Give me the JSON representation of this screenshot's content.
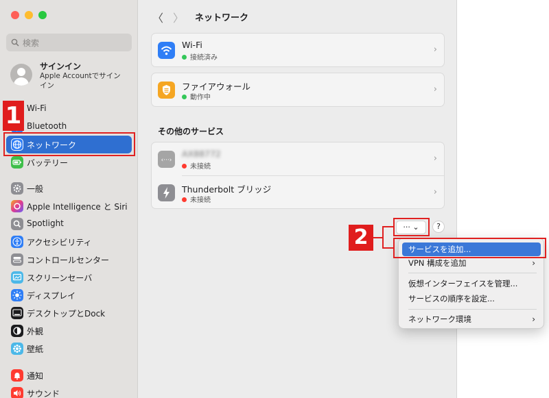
{
  "sidebar": {
    "search_placeholder": "検索",
    "account": {
      "title": "サインイン",
      "subtitle": "Apple Accountでサインイン"
    },
    "items": [
      {
        "label": "Wi-Fi",
        "icon": "wifi-icon",
        "color": "#2f7ef6"
      },
      {
        "label": "Bluetooth",
        "icon": "bluetooth-icon",
        "color": "#2f7ef6"
      },
      {
        "label": "ネットワーク",
        "icon": "globe-icon",
        "color": "#2f7ef6",
        "selected": true
      },
      {
        "label": "バッテリー",
        "icon": "battery-icon",
        "color": "#3fbf4a"
      },
      {
        "label": "一般",
        "icon": "gear-icon",
        "color": "#8e8e93"
      },
      {
        "label": "Apple Intelligence と Siri",
        "icon": "siri-icon",
        "color": "#c44bd6"
      },
      {
        "label": "Spotlight",
        "icon": "magnifier-icon",
        "color": "#8e8e93"
      },
      {
        "label": "アクセシビリティ",
        "icon": "accessibility-icon",
        "color": "#2f7ef6"
      },
      {
        "label": "コントロールセンター",
        "icon": "control-center-icon",
        "color": "#8e8e93"
      },
      {
        "label": "スクリーンセーバ",
        "icon": "screensaver-icon",
        "color": "#4cb8e8"
      },
      {
        "label": "ディスプレイ",
        "icon": "display-icon",
        "color": "#2f7ef6"
      },
      {
        "label": "デスクトップとDock",
        "icon": "dock-icon",
        "color": "#1c1c1e"
      },
      {
        "label": "外観",
        "icon": "appearance-icon",
        "color": "#1c1c1e"
      },
      {
        "label": "壁紙",
        "icon": "wallpaper-icon",
        "color": "#4cb8e8"
      },
      {
        "label": "通知",
        "icon": "bell-icon",
        "color": "#ff3b30"
      },
      {
        "label": "サウンド",
        "icon": "speaker-icon",
        "color": "#ff3b30"
      }
    ]
  },
  "header": {
    "title": "ネットワーク",
    "back": "〈",
    "forward": "〉"
  },
  "services": [
    {
      "name": "Wi-Fi",
      "status": "接続済み",
      "status_color": "#34c759",
      "icon": "wifi-icon",
      "color": "#2f7ef6"
    },
    {
      "name": "ファイアウォール",
      "status": "動作中",
      "status_color": "#34c759",
      "icon": "firewall-icon",
      "color": "#f5a623"
    }
  ],
  "other_section_title": "その他のサービス",
  "other_services": [
    {
      "name": "AX88772",
      "status": "未接続",
      "status_color": "#ff3b30",
      "icon": "ethernet-icon",
      "color": "#9b9b9b"
    },
    {
      "name": "Thunderbolt ブリッジ",
      "status": "未接続",
      "status_color": "#ff3b30",
      "icon": "thunderbolt-icon",
      "color": "#8e8e93"
    }
  ],
  "actions": {
    "more_label": "··· ⌄",
    "help_label": "?"
  },
  "menu": {
    "items": [
      {
        "label": "サービスを追加...",
        "highlighted": true
      },
      {
        "label": "VPN 構成を追加",
        "submenu": "›"
      },
      {
        "label": "仮想インターフェイスを管理..."
      },
      {
        "label": "サービスの順序を設定..."
      },
      {
        "label": "ネットワーク環境",
        "submenu": "›"
      }
    ]
  },
  "annotations": {
    "badge1": "1",
    "badge2": "2",
    "color": "#e02020"
  }
}
